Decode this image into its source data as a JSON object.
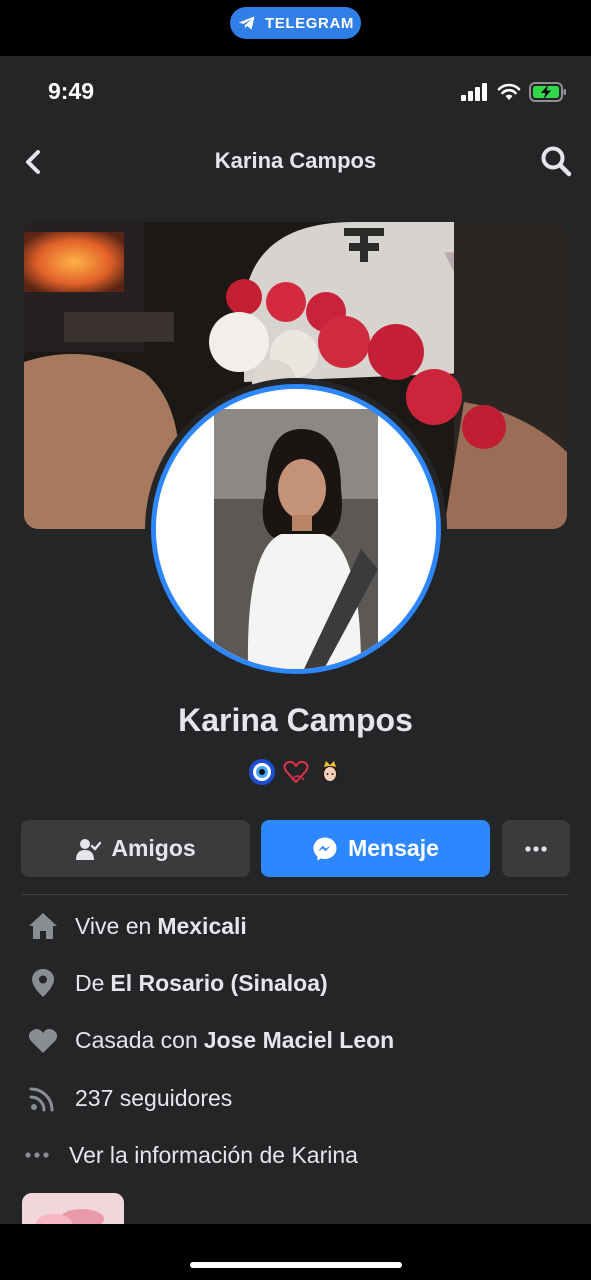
{
  "banner": {
    "label": "TELEGRAM",
    "color": "#2f7fe6"
  },
  "status": {
    "time": "9:49"
  },
  "nav": {
    "title": "Karina Campos"
  },
  "profile": {
    "name": "Karina Campos",
    "emojis": [
      "evil-eye",
      "heart-outline",
      "princess"
    ]
  },
  "actions": {
    "friends_label": "Amigos",
    "message_label": "Mensaje",
    "more_label": "..."
  },
  "info": {
    "lives_prefix": "Vive en",
    "lives_value": "Mexicali",
    "from_prefix": "De",
    "from_value": "El Rosario (Sinaloa)",
    "married_prefix": "Casada con",
    "married_value": "Jose Maciel Leon",
    "followers": "237 seguidores",
    "see_info": "Ver la información de Karina"
  },
  "colors": {
    "accent": "#2d88ff",
    "background": "#242526",
    "button": "#3a3b3c"
  }
}
